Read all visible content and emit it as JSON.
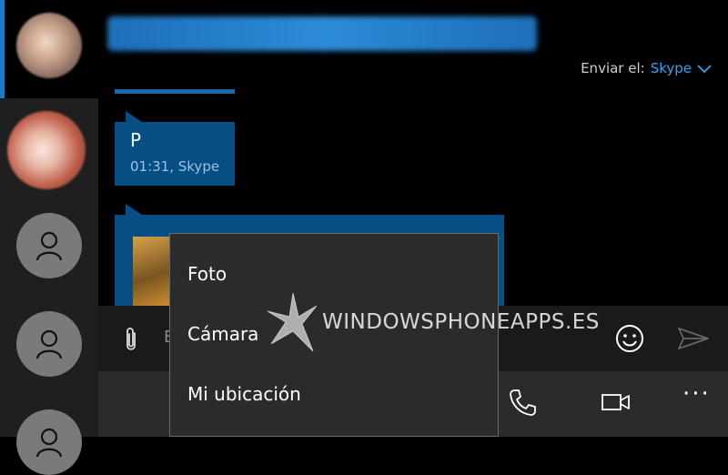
{
  "header": {
    "send_via_label": "Enviar el:",
    "send_via_service": "Skype"
  },
  "messages": [
    {
      "text": "P",
      "meta": "01:31, Skype"
    }
  ],
  "composer": {
    "hint": "E"
  },
  "attach_menu": {
    "items": [
      "Foto",
      "Cámara",
      "Mi ubicación"
    ]
  },
  "watermark": {
    "text": "WINDOWSPHONEAPPS.ES"
  },
  "colors": {
    "accent": "#3aa0ea",
    "bubble": "#064e83",
    "sidebar": "#1f1f1f",
    "menu": "#2b2b2b"
  },
  "icons": [
    "chevron-down-icon",
    "paperclip-icon",
    "emoji-icon",
    "send-icon",
    "phone-icon",
    "video-icon",
    "more-icon",
    "person-icon"
  ]
}
